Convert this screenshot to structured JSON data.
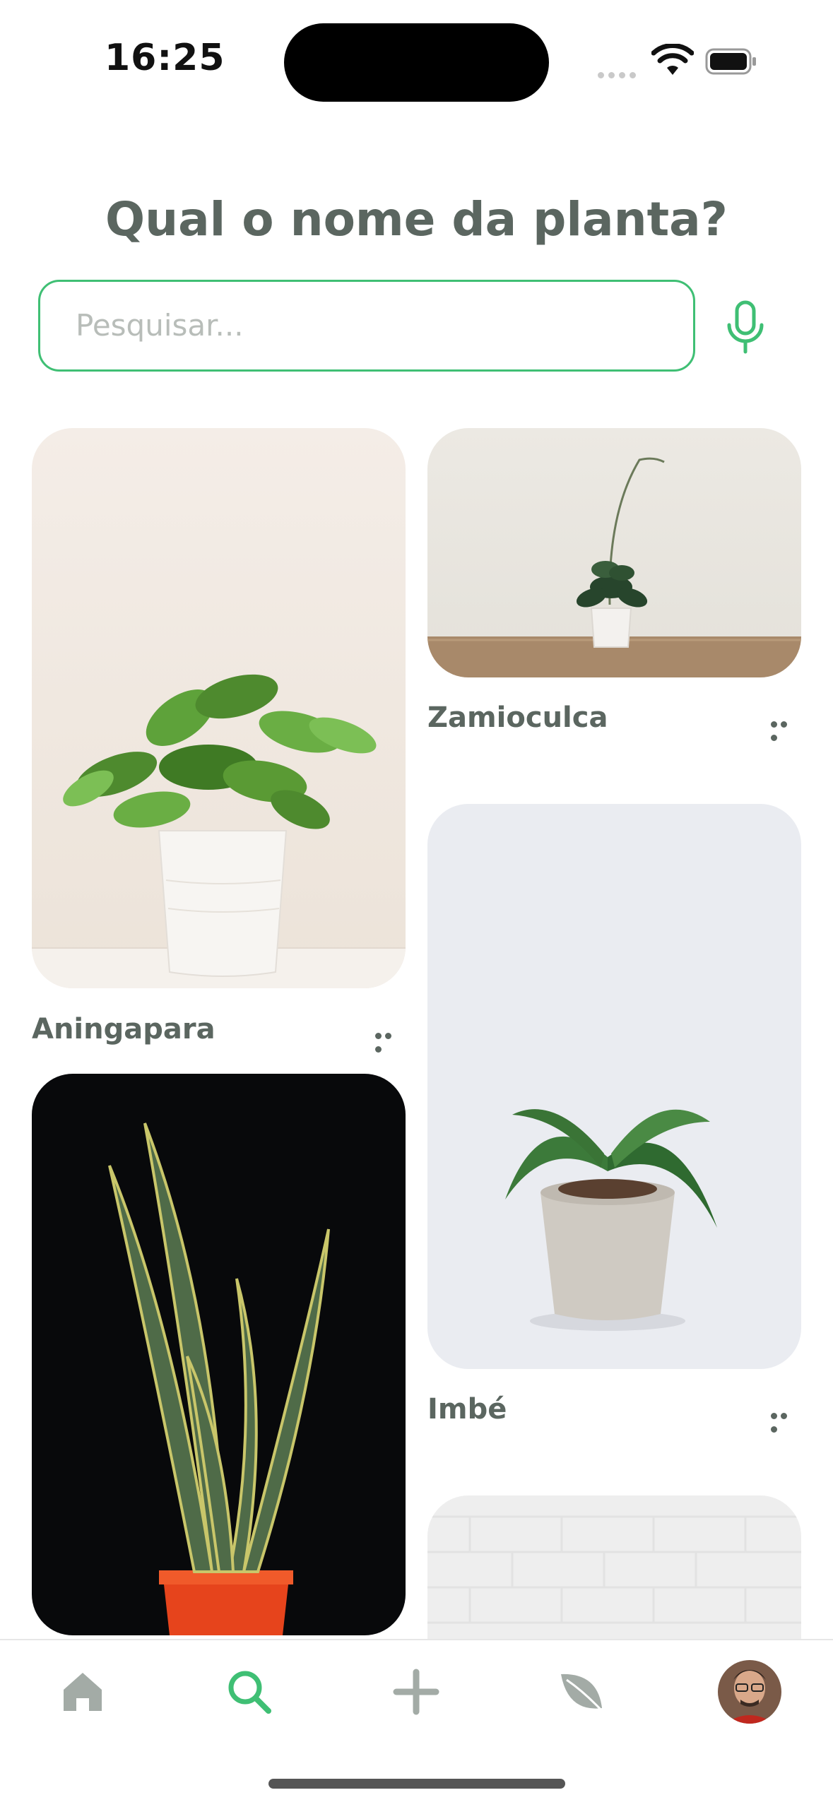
{
  "status_bar": {
    "time": "16:25"
  },
  "header": {
    "title": "Qual o nome da planta?"
  },
  "search": {
    "placeholder": "Pesquisar..."
  },
  "plants": [
    {
      "name": "Aningapara"
    },
    {
      "name": "Zamioculca"
    },
    {
      "name": "Imbé"
    }
  ],
  "tab_bar": {
    "items": [
      "home-icon",
      "search-icon",
      "plus-icon",
      "leaf-icon",
      "avatar"
    ],
    "active": "search-icon"
  },
  "colors": {
    "accent": "#3fbf74",
    "text": "#5b6660",
    "inactive_icon": "#a3aba6"
  }
}
